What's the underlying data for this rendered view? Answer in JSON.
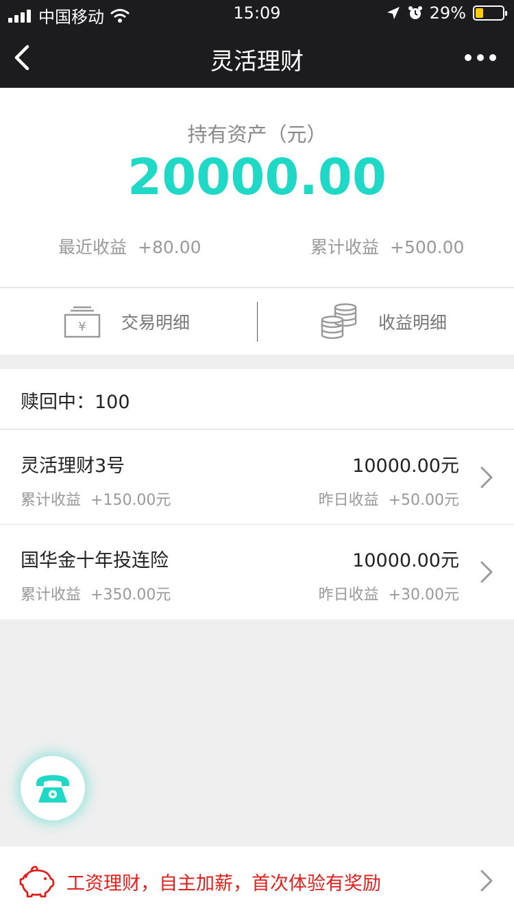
{
  "status_bar": {
    "carrier": "中国移动",
    "time": "15:09",
    "battery_percent": "29%",
    "battery_level": 0.29
  },
  "nav": {
    "title": "灵活理财"
  },
  "asset": {
    "label": "持有资产（元）",
    "value": "20000.00",
    "recent_label": "最近收益",
    "recent_value": "+80.00",
    "total_label": "累计收益",
    "total_value": "+500.00",
    "value_color": "#1fd8c6"
  },
  "actions": {
    "transactions_label": "交易明细",
    "earnings_label": "收益明细"
  },
  "redeem": {
    "text": "赎回中：100"
  },
  "products": [
    {
      "name": "灵活理财3号",
      "amount": "10000.00元",
      "cum_label": "累计收益",
      "cum_value": "+150.00元",
      "yest_label": "昨日收益",
      "yest_value": "+50.00元"
    },
    {
      "name": "国华金十年投连险",
      "amount": "10000.00元",
      "cum_label": "累计收益",
      "cum_value": "+350.00元",
      "yest_label": "昨日收益",
      "yest_value": "+30.00元"
    }
  ],
  "promo": {
    "text": "工资理财，自主加薪，首次体验有奖励",
    "color": "#e0201b"
  },
  "icons": {
    "fab": "phone-icon",
    "promo": "piggy-bank-icon"
  }
}
